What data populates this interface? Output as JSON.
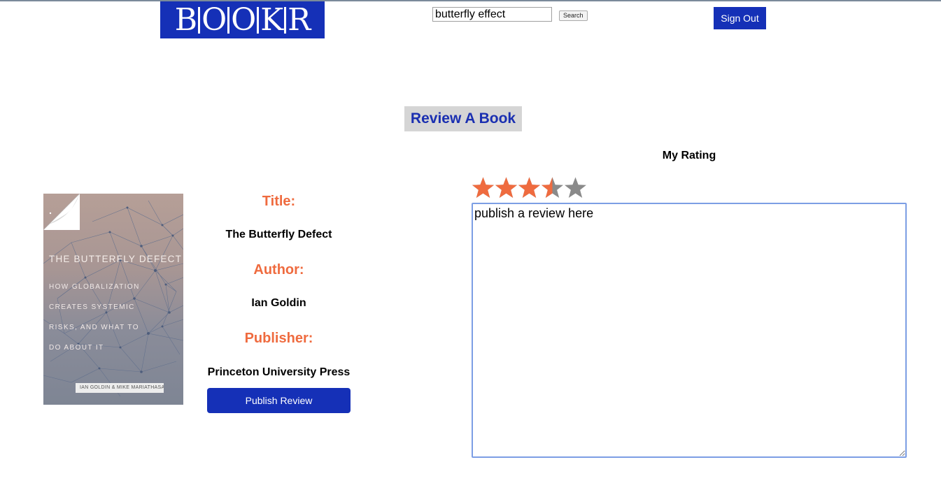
{
  "header": {
    "logo_text": "BOOKR",
    "logo_color": "#1530b7",
    "search": {
      "value": "butterfly effect",
      "button_label": "Search"
    },
    "sign_out_label": "Sign Out"
  },
  "page": {
    "heading": "Review A Book",
    "accent_color": "#ef6b3f"
  },
  "book": {
    "cover": {
      "title": "THE BUTTERFLY DEFECT",
      "subtitle_lines": [
        "HOW GLOBALIZATION",
        "CREATES SYSTEMIC",
        "RISKS, AND WHAT TO",
        "DO ABOUT IT"
      ],
      "authors": "IAN GOLDIN & MIKE MARIATHASAN"
    },
    "title_label": "Title:",
    "title_value": "The Butterfly Defect",
    "author_label": "Author:",
    "author_value": "Ian Goldin",
    "publisher_label": "Publisher:",
    "publisher_value": "Princeton University Press",
    "publish_button_label": "Publish Review"
  },
  "rating": {
    "label": "My Rating",
    "value": 3.5,
    "max": 5,
    "filled_color": "#ef6b3f",
    "empty_color": "#8a8a8a"
  },
  "review": {
    "text": "publish a review here"
  }
}
